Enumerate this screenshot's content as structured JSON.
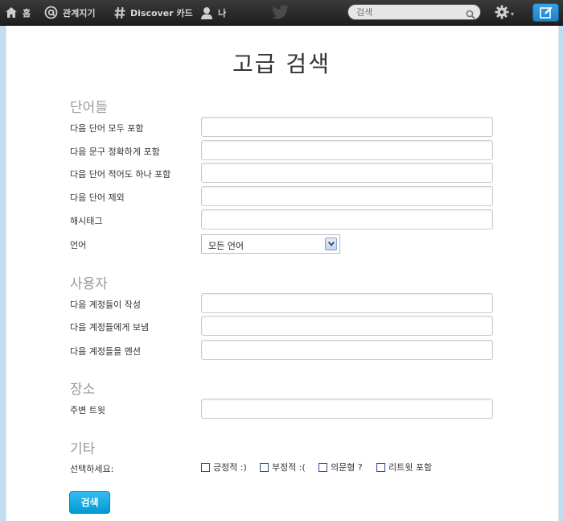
{
  "nav": {
    "home_label": "홈",
    "connect_label": "관계지기",
    "discover_label": "Discover 카드",
    "me_label": "나"
  },
  "search": {
    "placeholder": "검색"
  },
  "icons": {
    "home": "home-icon",
    "connect": "at-sign-icon",
    "discover": "hashtag-icon",
    "me": "person-icon",
    "logo": "twitter-bird-icon",
    "search": "magnifier-icon",
    "settings": "gear-icon",
    "compose": "compose-tweet-icon"
  },
  "colors": {
    "accent": "#1da1f2",
    "topbar": "#2a2a2a",
    "background": "#c0deed"
  },
  "page_title": "고급 검색",
  "sections": {
    "words": {
      "title": "단어들",
      "fields": [
        {
          "label": "다음 단어 모두 포함",
          "value": ""
        },
        {
          "label": "다음 문구 정확하게 포함",
          "value": ""
        },
        {
          "label": "다음 단어 적어도 하나 포함",
          "value": ""
        },
        {
          "label": "다음 단어 제외",
          "value": ""
        },
        {
          "label": "해시태그",
          "value": ""
        }
      ],
      "language": {
        "label": "언어",
        "selected": "모든 언어"
      }
    },
    "people": {
      "title": "사용자",
      "fields": [
        {
          "label": "다음 계정들이 작성",
          "value": ""
        },
        {
          "label": "다음 계정들에게 보냄",
          "value": ""
        },
        {
          "label": "다음 계정들을 멘션",
          "value": ""
        }
      ]
    },
    "places": {
      "title": "장소",
      "fields": [
        {
          "label": "주변 트윗",
          "value": ""
        }
      ]
    },
    "other": {
      "title": "기타",
      "select_label": "선택하세요:",
      "options": [
        {
          "label": "긍정적 :)",
          "checked": false
        },
        {
          "label": "부정적 :(",
          "checked": false
        },
        {
          "label": "의문형 ?",
          "checked": false
        },
        {
          "label": "리트윗 포함",
          "checked": false
        }
      ]
    }
  },
  "submit_label": "검색"
}
